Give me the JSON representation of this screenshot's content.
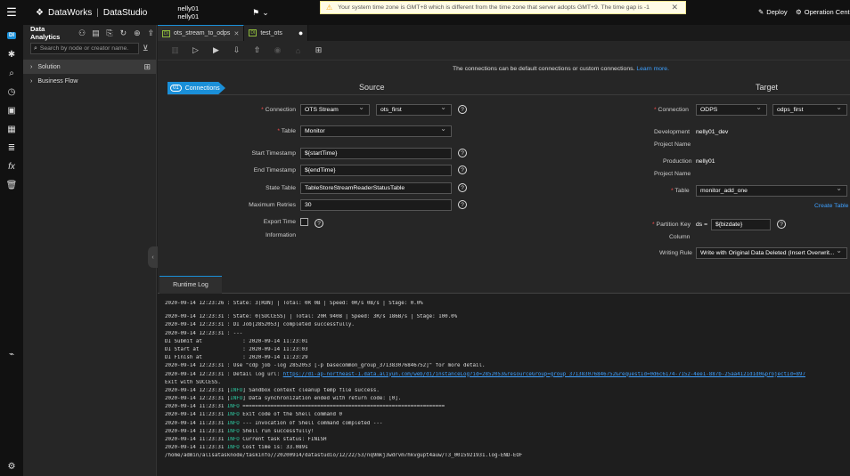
{
  "topbar": {
    "brand": "DataWorks",
    "product": "DataStudio",
    "user_line1": "nelly01",
    "user_line2": "nelly01",
    "timezone_warning": "Your system time zone is GMT+8 which is different from the time zone that server adopts GMT+9. The time gap is -1",
    "deploy_label": "Deploy",
    "operation_center_label": "Operation Center"
  },
  "explorer": {
    "title": "Data Analytics",
    "search_placeholder": "Search by node or creator name.",
    "tree": [
      {
        "label": "Solution"
      },
      {
        "label": "Business Flow"
      }
    ]
  },
  "tabs": [
    {
      "label": "ots_stream_to_odps",
      "badge": "DI"
    },
    {
      "label": "test_ots",
      "badge": "DI"
    }
  ],
  "content": {
    "notice_text": "The connections can be default connections or custom connections.",
    "notice_link": "Learn more.",
    "step_num": "01",
    "step_label": "Connections",
    "source_title": "Source",
    "target_title": "Target",
    "source": {
      "connection_label": "Connection",
      "connection_type": "OTS Stream",
      "connection_name": "ots_first",
      "table_label": "Table",
      "table_value": "Monitor",
      "start_ts_label": "Start Timestamp",
      "start_ts_value": "${startTime}",
      "end_ts_label": "End Timestamp",
      "end_ts_value": "${endTime}",
      "state_table_label": "State Table",
      "state_table_value": "TableStoreStreamReaderStatusTable",
      "max_retries_label": "Maximum Retries",
      "max_retries_value": "30",
      "export_time_label_1": "Export Time",
      "export_time_label_2": "Information"
    },
    "target": {
      "connection_label": "Connection",
      "connection_type": "ODPS",
      "connection_name": "odps_first",
      "dev_project_label_1": "Development",
      "dev_project_label_2": "Project Name",
      "dev_project_value": "nelly01_dev",
      "prod_project_label_1": "Production",
      "prod_project_label_2": "Project Name",
      "prod_project_value": "nelly01",
      "table_label": "Table",
      "table_value": "monitor_add_one",
      "create_table": "Create Table",
      "partition_label_1": "Partition Key",
      "partition_label_2": "Column",
      "partition_key": "ds =",
      "partition_value": "${bizdate}",
      "writing_rule_label": "Writing Rule",
      "writing_rule_value": "Write with Original Data Deleted (Insert Overwrit..."
    }
  },
  "log": {
    "tab_label": "Runtime Log",
    "lines": [
      "2020-09-14 12:23:26 : State: 3(RUN) | Total: 0R 0B | Speed: 0R/s 0B/s | Stage: 0.0%",
      "",
      "2020-09-14 12:23:31 : State: 0(SUCCESS) | Total: 20R 940B | Speed: 3R/s 186B/s | Stage: 100.0%",
      "2020-09-14 12:23:31 : DI Job[2852053] completed successfully.",
      "2020-09-14 12:23:31 : ---",
      "DI Submit at             : 2020-09-14 11:23:01",
      "DI Start at              : 2020-09-14 11:23:03",
      "DI Finish at             : 2020-09-14 11:23:29",
      "2020-09-14 12:23:31 : Use \"cdp job -log 2852053 [-p basecommon_group_371383076846752]\" for more detail.",
      "2020-09-14 12:23:31 : Detail log url: ",
      "Exit with SUCCESS.",
      "2020-09-14 12:23:31 [INFO] Sandbox context cleanup temp file success.",
      "2020-09-14 12:23:31 [INFO] Data synchronization ended with return code: [0].",
      "2020-09-14 11:23:31 INFO =================================================================",
      "2020-09-14 11:23:31 INFO Exit code of the Shell command 0",
      "2020-09-14 11:23:31 INFO --- Invocation of Shell command completed ---",
      "2020-09-14 11:23:31 INFO Shell run successfully!",
      "2020-09-14 11:23:31 INFO Current task status: FINISH",
      "2020-09-14 11:23:31 INFO Cost time is: 33.089s",
      "/home/admin/alisatasknode/taskinfo//20200914/datastudio/12/22/53/nq9mkj3wdrvm7hkvgupt4auw/T3_0015921931.log-END-EOF"
    ],
    "detail_url": "https://di-ap-northeast-1.data.aliyun.com/web/di/instanceLog?id=2852053&resourceGroup=group_371383076846752&requestId=0d6c6174-7152-4ee1-887b-25aa4121d1d0&projectId=897"
  }
}
